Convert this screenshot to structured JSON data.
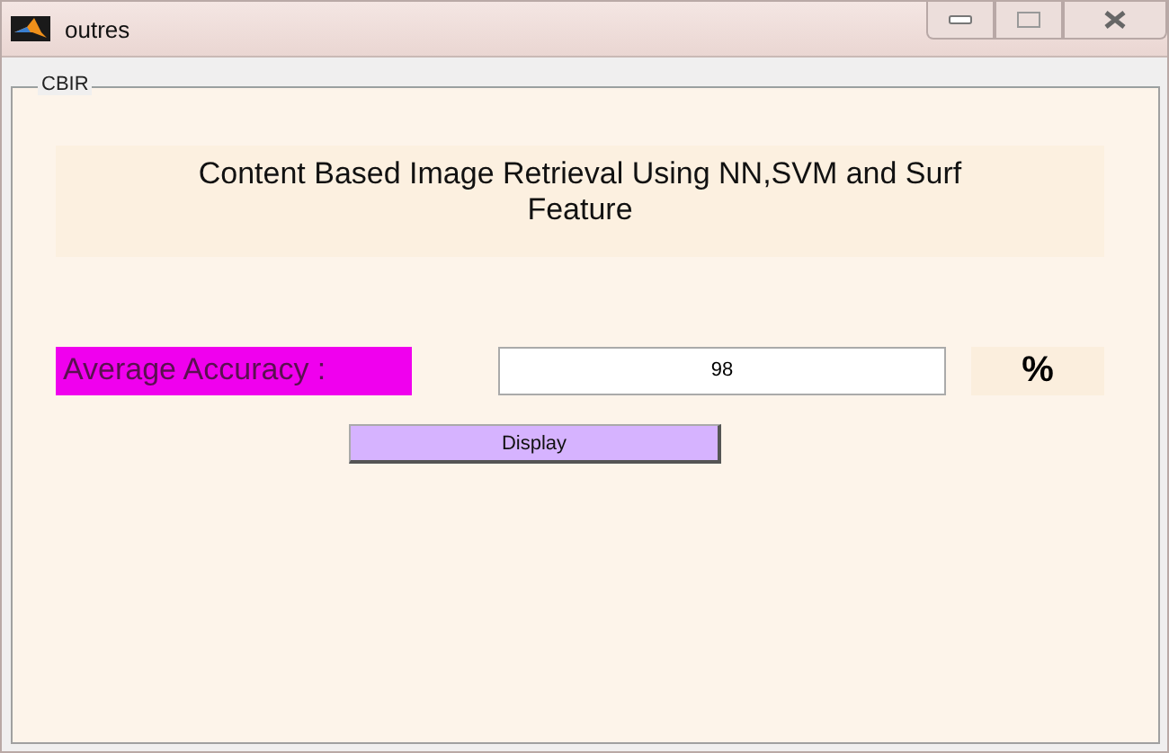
{
  "window": {
    "title": "outres"
  },
  "panel": {
    "title": "CBIR"
  },
  "heading": "Content Based Image Retrieval Using NN,SVM and Surf Feature",
  "accuracy": {
    "label": "Average Accuracy :",
    "value": "98",
    "unit": "%"
  },
  "buttons": [
    "Display"
  ]
}
